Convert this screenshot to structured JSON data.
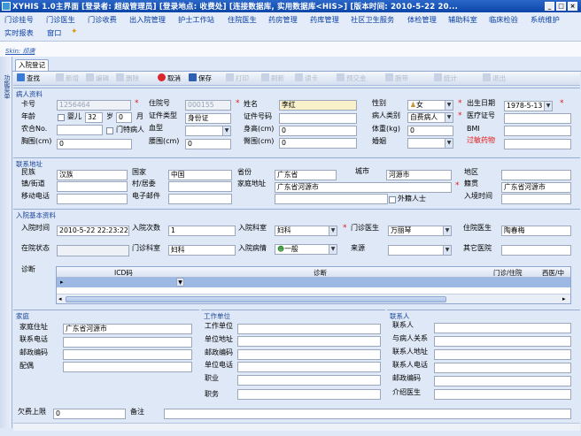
{
  "window": {
    "title": "XYHIS 1.0主界面    [登录者: 超级管理员] [登录地点: 收费处] [连接数据库, 实用数据库<HIS>] [版本时间: 2010-5-22 20..."
  },
  "menu": {
    "row1": [
      "门诊挂号",
      "门诊医生",
      "门诊收费",
      "出入院管理",
      "护士工作站",
      "住院医生",
      "药房管理",
      "药库管理",
      "社区卫生服务",
      "体检管理",
      "辅助科室",
      "临床检验",
      "系统维护"
    ],
    "row2": [
      "实时报表",
      "窗口"
    ]
  },
  "skin_label": "Skin: 烦唐",
  "left_strip_label": "功能菜单",
  "doc_tab": "入院登记",
  "toolbar": {
    "find": "查找",
    "new": "新增",
    "edit": "编辑",
    "delete": "删除",
    "cancel": "取消",
    "save": "保存",
    "print": "打印",
    "refresh": "刷新",
    "card": "读卡",
    "prepay": "预交金",
    "wristband": "腕带",
    "stats": "统计",
    "exit": "退出"
  },
  "patient_info": {
    "section_title": "病人资料",
    "card_no_label": "卡号",
    "card_no": "1256464",
    "inpatient_no_label": "住院号",
    "inpatient_no": "000155",
    "name_label": "姓名",
    "name": "李红",
    "gender_label": "性别",
    "gender": "女",
    "birth_label": "出生日期",
    "birth": "1978-5-13",
    "age_label": "年龄",
    "infant_label": "婴儿",
    "age_years": "32",
    "years_unit": "岁",
    "age_months": "0",
    "months_unit": "月",
    "id_type_label": "证件类型",
    "id_type": "身份证",
    "id_no_label": "证件号码",
    "patient_type_label": "病人类别",
    "patient_type": "自费病人",
    "medical_card_label": "医疗证号",
    "rural_no_label": "农合No.",
    "special_label": "门特病人",
    "blood_label": "血型",
    "height_label": "身高(cm)",
    "height": "0",
    "weight_label": "体重(kg)",
    "weight": "0",
    "bmi_label": "BMI",
    "chest_label": "胸围(cm)",
    "chest": "0",
    "waist_label": "腰围(cm)",
    "waist": "0",
    "hip_label": "臀围(cm)",
    "hip": "0",
    "marital_label": "婚姻",
    "allergy_label": "过敏药物"
  },
  "contact_address": {
    "section_title": "联系地址",
    "ethnicity_label": "民族",
    "ethnicity": "汉族",
    "country_label": "国家",
    "country": "中国",
    "province_label": "省份",
    "province": "广东省",
    "city_label": "城市",
    "city": "河源市",
    "district_label": "地区",
    "town_label": "镇/街道",
    "village_label": "村/居委",
    "home_addr_label": "家庭地址",
    "home_addr": "广东省河源市",
    "native_label": "籍贯",
    "native": "广东省河源市",
    "mobile_label": "移动电话",
    "email_label": "电子邮件",
    "foreigner_label": "外籍人士",
    "entry_time_label": "入境时间"
  },
  "admission": {
    "section_title": "入院基本资料",
    "admit_time_label": "入院时间",
    "admit_time": "2010-5-22 22:23:22",
    "admit_count_label": "入院次数",
    "admit_count": "1",
    "dept_label": "入院科室",
    "dept": "妇科",
    "op_doctor_label": "门诊医生",
    "op_doctor": "万丽琴",
    "ward_doctor_label": "住院医生",
    "ward_doctor": "陶春梅",
    "status_label": "在院状态",
    "op_dept_label": "门诊科室",
    "op_dept": "妇科",
    "condition_label": "入院病情",
    "condition": "一般",
    "source_label": "来源",
    "other_hospital_label": "其它医院",
    "diagnosis_label": "诊断",
    "grid_headers": [
      "ICD码",
      "诊断",
      "门诊/住院",
      "西医/中"
    ]
  },
  "family": {
    "section_title": "家庭",
    "address_label": "家庭住址",
    "address": "广东省河源市",
    "phone_label": "联系电话",
    "zip_label": "邮政编码",
    "spouse_label": "配偶"
  },
  "work": {
    "section_title": "工作单位",
    "unit_label": "工作单位",
    "unit_addr_label": "单位地址",
    "zip_label": "邮政编码",
    "unit_phone_label": "单位电话",
    "job_label": "职业",
    "position_label": "职务"
  },
  "contact_person": {
    "section_title": "联系人",
    "person_label": "联系人",
    "relation_label": "与病人关系",
    "addr_label": "联系人地址",
    "phone_label": "联系人电话",
    "zip_label": "邮政编码",
    "doctor_label": "介绍医生"
  },
  "footer": {
    "arrears_label": "欠费上限",
    "arrears": "0",
    "remark_label": "备注"
  },
  "colors": {
    "titlebar": "#0d45a8",
    "required": "#e21b1b",
    "menu_text": "#0b3fa5",
    "section_title": "#17449a"
  }
}
